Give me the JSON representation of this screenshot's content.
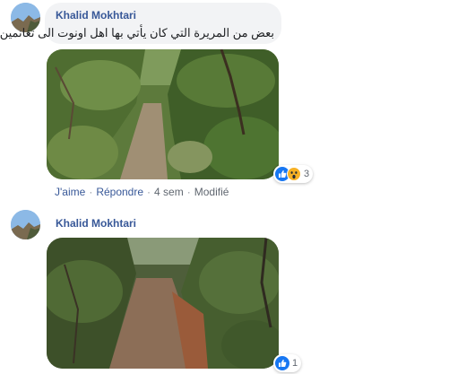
{
  "comments": [
    {
      "author": "Khalid Mokhtari",
      "text": "بعض من المريرة التي كان يأتي بها اهل اونوت الى تغانمين",
      "reaction_count": "3",
      "actions": {
        "like": "J'aime",
        "reply": "Répondre",
        "time": "4 sem",
        "edited": "Modifié"
      }
    },
    {
      "author": "Khalid Mokhtari",
      "reaction_count": "1"
    }
  ],
  "colors": {
    "link": "#385898",
    "bubble": "#f2f3f5",
    "meta": "#606770",
    "like_blue": "#1877f2",
    "wow_yellow": "#f7b125"
  },
  "icons": [
    "like-icon",
    "wow-icon"
  ]
}
